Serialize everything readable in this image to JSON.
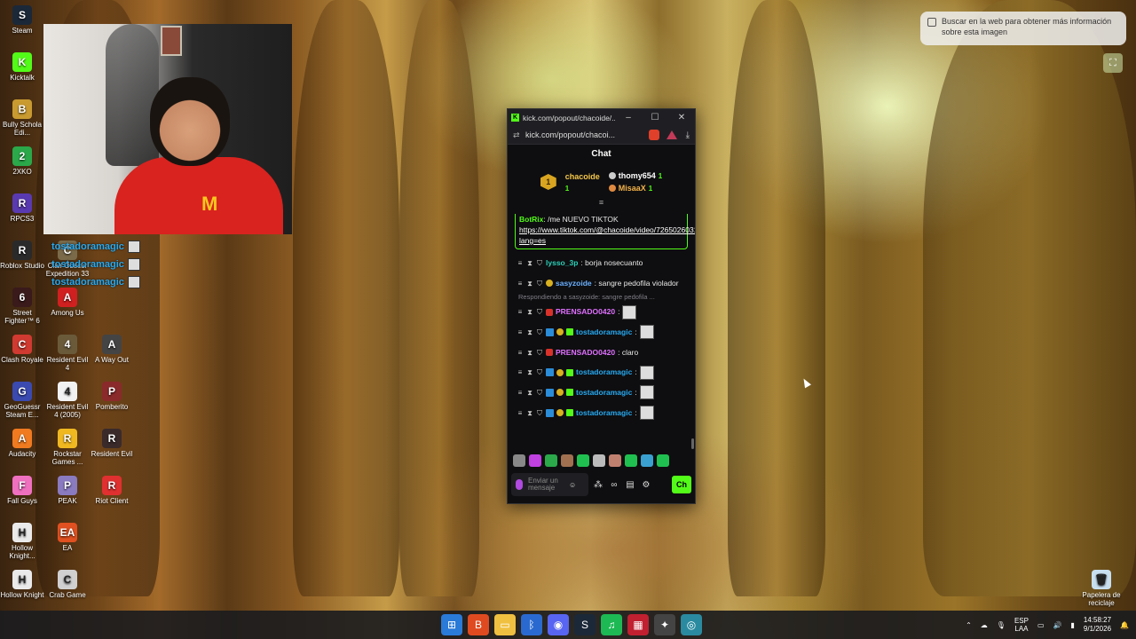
{
  "desktop": {
    "icons": [
      {
        "label": "Steam",
        "color": "#1b2838",
        "glyph": "S"
      },
      {
        "label": "Kicktalk",
        "color": "#53fc18",
        "glyph": "K"
      },
      {
        "label": "Bully Schola Edi...",
        "color": "#c89a30",
        "glyph": "B"
      },
      {
        "label": "2XKO",
        "color": "#2aa84a",
        "glyph": "2"
      },
      {
        "label": "RPCS3",
        "color": "#5a3ab0",
        "glyph": "R"
      },
      {
        "label": "Roblox Studio",
        "color": "#2a2a2a",
        "glyph": "R"
      },
      {
        "label": "Street Fighter™ 6",
        "color": "#3a1a1a",
        "glyph": "6"
      },
      {
        "label": "Clash Royale",
        "color": "#d03a30",
        "glyph": "C"
      },
      {
        "label": "GeoGuessr Steam E...",
        "color": "#3a4ab0",
        "glyph": "G"
      },
      {
        "label": "Audacity",
        "color": "#f07a20",
        "glyph": "A"
      },
      {
        "label": "Fall Guys",
        "color": "#f070c0",
        "glyph": "F"
      },
      {
        "label": "Hollow Knight...",
        "color": "#eaeaea",
        "glyph": "H"
      },
      {
        "label": "Hollow Knight",
        "color": "#eaeaea",
        "glyph": "H"
      },
      {
        "label": "Among Us",
        "color": "#d02020",
        "glyph": "A"
      },
      {
        "label": "Resident Evil 4",
        "color": "#6a5a3a",
        "glyph": "4"
      },
      {
        "label": "A Way Out",
        "color": "#444444",
        "glyph": "A"
      },
      {
        "label": "Resident Evil 4 (2005)",
        "color": "#f2f2f2",
        "glyph": "4"
      },
      {
        "label": "Pomberito",
        "color": "#8a2a2a",
        "glyph": "P"
      },
      {
        "label": "Rockstar Games ...",
        "color": "#f0b820",
        "glyph": "R"
      },
      {
        "label": "Resident Evil",
        "color": "#3a2a2a",
        "glyph": "R"
      },
      {
        "label": "PEAK",
        "color": "#8a7ac0",
        "glyph": "P"
      },
      {
        "label": "Riot Client",
        "color": "#e03030",
        "glyph": "R"
      },
      {
        "label": "EA",
        "color": "#e05020",
        "glyph": "EA"
      },
      {
        "label": "Crab Game",
        "color": "#d0d0d0",
        "glyph": "C"
      },
      {
        "label": "Clair Obscur Expedition 33",
        "color": "#7a6a4a",
        "glyph": "C"
      },
      {
        "label": "Papelera de reciclaje",
        "color": "#c8dff0",
        "glyph": "🗑"
      }
    ],
    "overlay_name": "tostadoramagic",
    "lens_popup": "Buscar en la web para obtener más información sobre esta imagen",
    "lens_icon": "⛶"
  },
  "popup": {
    "window_title": "kick.com/popout/chacoide/...",
    "url": "kick.com/popout/chacoi...",
    "chat_title": "Chat",
    "leaderboard": {
      "top": {
        "name": "chacoide",
        "count": "1",
        "rank": "1"
      },
      "second": {
        "name": "thomy654",
        "count": "1"
      },
      "third": {
        "name": "MisaaX",
        "count": "1"
      }
    },
    "pinned": {
      "user": "BotRix",
      "text": ": /me",
      "title": "NUEVO TIKTOK",
      "link": "https://www.tiktok.com/@chacoide/video/7265026031633878278?lang=es"
    },
    "messages": [
      {
        "user": "lysso_3p",
        "color": "#2bd0b8",
        "text": ": borja nosecuanto",
        "badges": []
      },
      {
        "user": "sasyzoide",
        "color": "#6ab0ff",
        "text": ": sangre pedofila violador",
        "badges": [
          "gold"
        ]
      },
      {
        "reply": "Respondiendo a sasyzoide: sangre pedofila ..."
      },
      {
        "user": "PRENSADO0420",
        "color": "#e070ff",
        "text": ":",
        "badges": [
          "red"
        ]
      },
      {
        "user": "tostadoramagic",
        "color": "#27a9f0",
        "text": ":",
        "badges": [
          "blue",
          "gold",
          "green"
        ]
      },
      {
        "user": "PRENSADO0420",
        "color": "#e070ff",
        "text": ": claro",
        "badges": [
          "red"
        ]
      },
      {
        "user": "tostadoramagic",
        "color": "#27a9f0",
        "text": ":",
        "badges": [
          "blue",
          "gold",
          "green"
        ]
      },
      {
        "user": "tostadoramagic",
        "color": "#27a9f0",
        "text": ":",
        "badges": [
          "blue",
          "gold",
          "green"
        ]
      },
      {
        "user": "tostadoramagic",
        "color": "#27a9f0",
        "text": ":",
        "badges": [
          "blue",
          "gold",
          "green"
        ]
      }
    ],
    "input_placeholder": "Enviar un mensaje",
    "send_label": "Ch"
  },
  "taskbar": {
    "lang_line1": "ESP",
    "lang_line2": "LAA",
    "time": "14:58:27",
    "date": "9/1/2026"
  },
  "colors": {
    "kick_green": "#53fc18"
  }
}
